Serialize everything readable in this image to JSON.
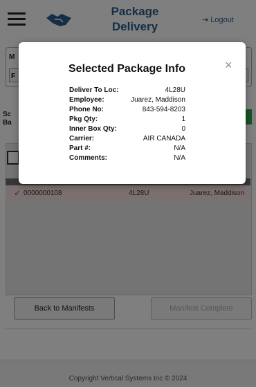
{
  "header": {
    "title_line1": "Package",
    "title_line2": "Delivery",
    "logout_label": "Logout",
    "logout_icon": "sign-out-icon",
    "menu_icon": "hamburger-icon",
    "logo_icon": "handshake-icon"
  },
  "background": {
    "manifest_label_fragment": "M",
    "manifest_value_fragment": "F",
    "scan_label_line1": "Sc",
    "scan_label_line2": "Ba",
    "row": {
      "check_icon": "check-icon",
      "package_id": "0000000108",
      "location": "4L28U",
      "employee": "Juarez, Maddison"
    },
    "back_label": "Back to Manifests",
    "complete_label": "Manifest Complete"
  },
  "modal": {
    "title": "Selected Package Info",
    "close_label": "×",
    "fields": [
      {
        "label": "Deliver To Loc:",
        "value": "4L28U"
      },
      {
        "label": "Employee:",
        "value": "Juarez, Maddison"
      },
      {
        "label": "Phone No:",
        "value": "843-594-8203"
      },
      {
        "label": "Pkg Qty:",
        "value": "1"
      },
      {
        "label": "Inner Box Qty:",
        "value": "0"
      },
      {
        "label": "Carrier:",
        "value": "AIR CANADA"
      },
      {
        "label": "Part #:",
        "value": "N/A"
      },
      {
        "label": "Comments:",
        "value": "N/A"
      }
    ]
  },
  "footer": {
    "copyright": "Copyright Vertical Systems Inc © 2024"
  },
  "colors": {
    "brand": "#2a5d8c",
    "success": "#2fa84f",
    "selected_row": "#f6dede"
  }
}
